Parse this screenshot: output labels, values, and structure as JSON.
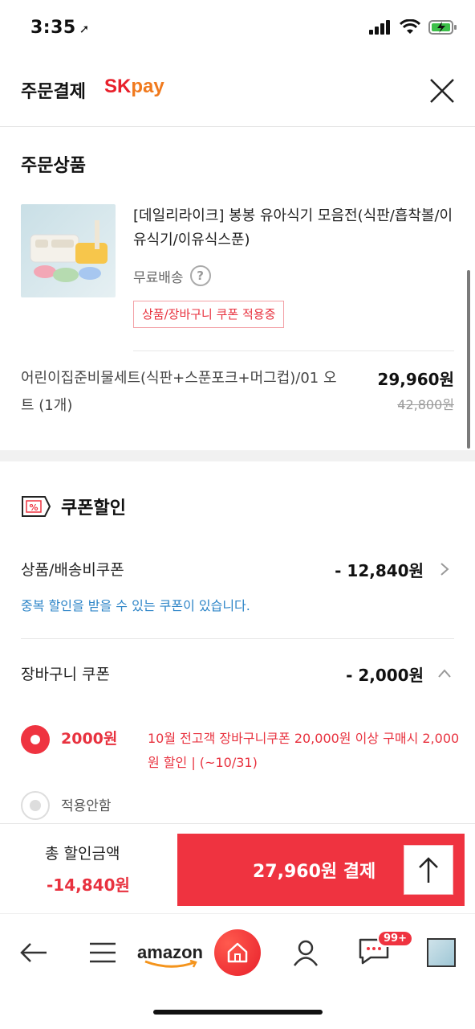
{
  "status": {
    "time": "3:35"
  },
  "header": {
    "title": "주문결제",
    "logo_sk": "SK",
    "logo_pay": "pay"
  },
  "product_section": {
    "title": "주문상품",
    "product_name": "[데일리라이크] 봉봉 유아식기 모음전(식판/흡착볼/이유식기/이유식스푼)",
    "free_shipping": "무료배송",
    "help_symbol": "?",
    "coupon_tag": "상품/장바구니 쿠폰 적용중",
    "option": "어린이집준비물세트(식판+스푼포크+머그컵)/01 오트 (1개)",
    "price": "29,960원",
    "original_price": "42,800원"
  },
  "coupon_section": {
    "title": "쿠폰할인",
    "product_coupon_label": "상품/배송비쿠폰",
    "product_coupon_value": "- 12,840원",
    "duplicate_note": "중복 할인을 받을 수 있는 쿠폰이 있습니다.",
    "cart_coupon_label": "장바구니 쿠폰",
    "cart_coupon_value": "- 2,000원",
    "options": [
      {
        "amount": "2000원",
        "desc": "10월 전고객 장바구니쿠폰 20,000원 이상 구매시 2,000원 할인 | (~10/31)",
        "selected": true
      },
      {
        "label": "적용안함",
        "selected": false
      }
    ]
  },
  "footer": {
    "total_label": "총 할인금액",
    "total_value": "-14,840원",
    "pay_label": "27,960원 결제"
  },
  "bottom_nav": {
    "amazon": "amazon",
    "badge": "99+"
  },
  "colors": {
    "accent": "#ef3340",
    "link": "#2c84c7",
    "sk_red": "#e8202b",
    "pay_orange": "#f07a1e"
  }
}
